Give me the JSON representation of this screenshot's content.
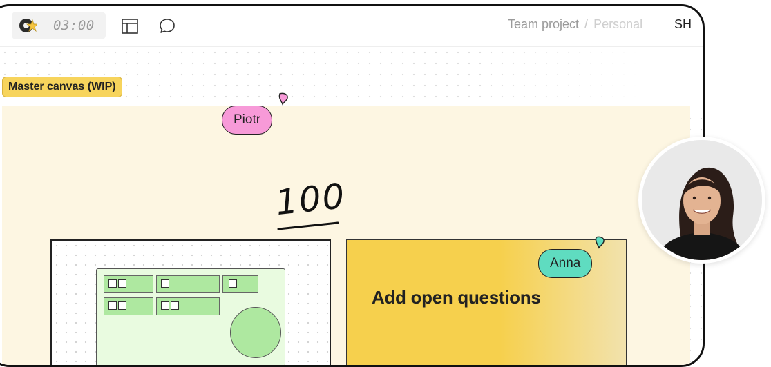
{
  "toolbar": {
    "timer": "03:00",
    "breadcrumb": {
      "team": "Team project",
      "separator": "/",
      "page": "Personal"
    },
    "share_fragment": "SH"
  },
  "canvas": {
    "frame_label": "Master canvas (WIP)",
    "handwriting": "100",
    "sticky_note_text": "Add open questions"
  },
  "cursors": [
    {
      "name": "Piotr",
      "color": "#f79ad8"
    },
    {
      "name": "Anna",
      "color": "#5fdcc0"
    }
  ],
  "colors": {
    "frame_background": "#fdf6e2",
    "frame_label": "#f7d45c",
    "sticky_note": "#f6d04d",
    "wireframe_green": "#aee8a0"
  }
}
